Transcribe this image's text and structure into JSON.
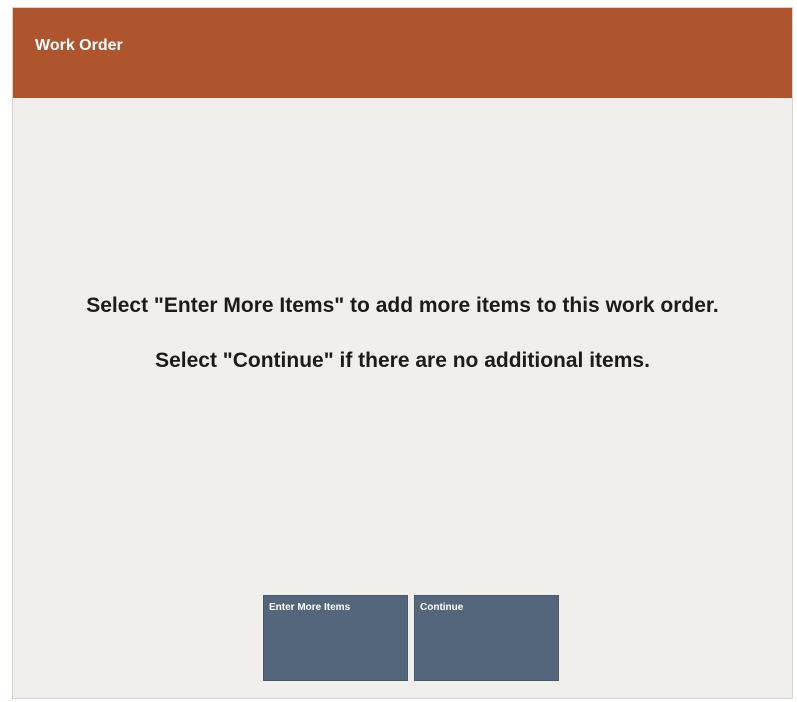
{
  "dialog": {
    "title": "Work Order",
    "message_line1": "Select \"Enter More Items\" to add more items to this work order.",
    "message_line2": "Select \"Continue\" if there are no additional items."
  },
  "buttons": {
    "enter_more_items": "Enter More Items",
    "continue": "Continue"
  },
  "colors": {
    "title_bar": "#ae552e",
    "body_background": "#f1efeb",
    "button": "#53667b"
  }
}
